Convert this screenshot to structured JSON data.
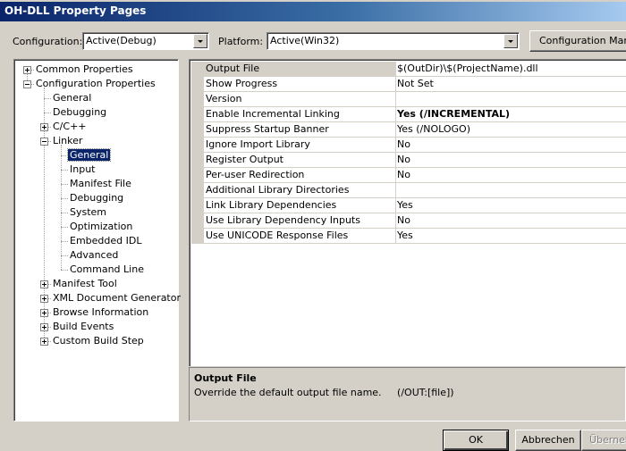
{
  "window": {
    "title": "OH-DLL Property Pages"
  },
  "toolbar": {
    "configuration_label": "Configuration:",
    "configuration_value": "Active(Debug)",
    "platform_label": "Platform:",
    "platform_value": "Active(Win32)",
    "config_manager_label": "Configuration Manager..."
  },
  "tree": {
    "nodes": [
      {
        "label": "Common Properties",
        "expander": "plus"
      },
      {
        "label": "Configuration Properties",
        "expander": "minus"
      },
      {
        "label": "General"
      },
      {
        "label": "Debugging"
      },
      {
        "label": "C/C++",
        "expander": "plus"
      },
      {
        "label": "Linker",
        "expander": "minus"
      },
      {
        "label": "General",
        "selected": true
      },
      {
        "label": "Input"
      },
      {
        "label": "Manifest File"
      },
      {
        "label": "Debugging"
      },
      {
        "label": "System"
      },
      {
        "label": "Optimization"
      },
      {
        "label": "Embedded IDL"
      },
      {
        "label": "Advanced"
      },
      {
        "label": "Command Line"
      },
      {
        "label": "Manifest Tool",
        "expander": "plus"
      },
      {
        "label": "XML Document Generator",
        "expander": "plus"
      },
      {
        "label": "Browse Information",
        "expander": "plus"
      },
      {
        "label": "Build Events",
        "expander": "plus"
      },
      {
        "label": "Custom Build Step",
        "expander": "plus"
      }
    ]
  },
  "properties": [
    {
      "name": "Output File",
      "value": "$(OutDir)\\$(ProjectName).dll",
      "selected": true
    },
    {
      "name": "Show Progress",
      "value": "Not Set"
    },
    {
      "name": "Version",
      "value": ""
    },
    {
      "name": "Enable Incremental Linking",
      "value": "Yes (/INCREMENTAL)",
      "bold": true
    },
    {
      "name": "Suppress Startup Banner",
      "value": "Yes (/NOLOGO)"
    },
    {
      "name": "Ignore Import Library",
      "value": "No"
    },
    {
      "name": "Register Output",
      "value": "No"
    },
    {
      "name": "Per-user Redirection",
      "value": "No"
    },
    {
      "name": "Additional Library Directories",
      "value": ""
    },
    {
      "name": "Link Library Dependencies",
      "value": "Yes"
    },
    {
      "name": "Use Library Dependency Inputs",
      "value": "No"
    },
    {
      "name": "Use UNICODE Response Files",
      "value": "Yes"
    }
  ],
  "description": {
    "title": "Output File",
    "text": "Override the default output file name.     (/OUT:[file])"
  },
  "buttons": {
    "ok": "OK",
    "cancel": "Abbrechen",
    "apply": "Übernehmen"
  }
}
